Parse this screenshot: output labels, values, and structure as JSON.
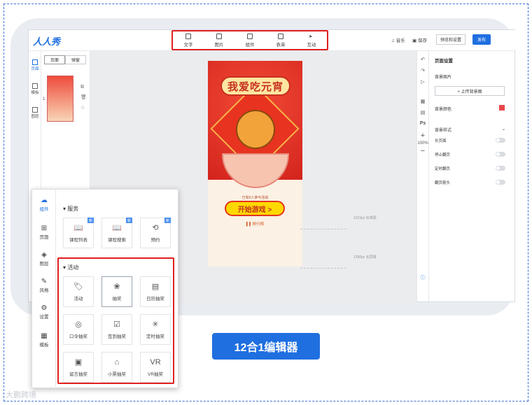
{
  "app": {
    "logo": "人人秀"
  },
  "toolbar": {
    "items": [
      {
        "label": "文字",
        "icon": "text-icon"
      },
      {
        "label": "图片",
        "icon": "image-icon"
      },
      {
        "label": "组件",
        "icon": "component-icon"
      },
      {
        "label": "表单",
        "icon": "form-icon"
      },
      {
        "label": "互动",
        "icon": "interact-icon"
      }
    ],
    "music": "音乐",
    "save": "保存",
    "preview_settings": "预览和设置",
    "publish": "发布"
  },
  "leftrail": {
    "items": [
      {
        "label": "页面"
      },
      {
        "label": "模板"
      },
      {
        "label": "图层"
      }
    ]
  },
  "pagepanel": {
    "tabs": [
      "页面",
      "弹窗"
    ],
    "page_num": "1"
  },
  "phone": {
    "title": "我爱吃元宵",
    "joined": "已有5人参与活动",
    "start": "开始游戏 >",
    "rank": "排行榜"
  },
  "guides": {
    "g1": "1015px 标准屏",
    "g2": "1280px 长屏幕"
  },
  "rtools": {
    "zoom": "100%",
    "ps": "Ps"
  },
  "props": {
    "title": "页面设置",
    "bg_image": "背景图片",
    "upload": "+ 上传背景图",
    "bg_color": "背景颜色",
    "bg_style": "背景样式",
    "opts": [
      "长页面",
      "停止翻页",
      "定时翻页",
      "翻页箭头"
    ],
    "accent": "#e9464c"
  },
  "overlay": {
    "rail": [
      {
        "label": "组件",
        "icon": "☁"
      },
      {
        "label": "页面",
        "icon": "⊞"
      },
      {
        "label": "图层",
        "icon": "◈"
      },
      {
        "label": "风格",
        "icon": "✎"
      },
      {
        "label": "设置",
        "icon": "⚙"
      },
      {
        "label": "模板",
        "icon": "▦"
      }
    ],
    "service_title": "服务",
    "services": [
      {
        "label": "课程列表",
        "icon": "📖",
        "badge": "新"
      },
      {
        "label": "课程搜索",
        "icon": "📖",
        "badge": "新"
      },
      {
        "label": "预约",
        "icon": "⟲",
        "badge": "新"
      }
    ],
    "activity_title": "活动",
    "activities": [
      {
        "label": "活动",
        "icon": "🏷"
      },
      {
        "label": "抽奖",
        "icon": "❀"
      },
      {
        "label": "日历抽奖",
        "icon": "▤"
      },
      {
        "label": "口令抽奖",
        "icon": "◎"
      },
      {
        "label": "签到抽奖",
        "icon": "☑"
      },
      {
        "label": "定时抽奖",
        "icon": "✳"
      },
      {
        "label": "留言抽奖",
        "icon": "▣"
      },
      {
        "label": "小票抽奖",
        "icon": "⌂"
      },
      {
        "label": "VR抽奖",
        "icon": "VR"
      }
    ]
  },
  "banner": "12合1编辑器",
  "watermark": "大鹏跨境"
}
